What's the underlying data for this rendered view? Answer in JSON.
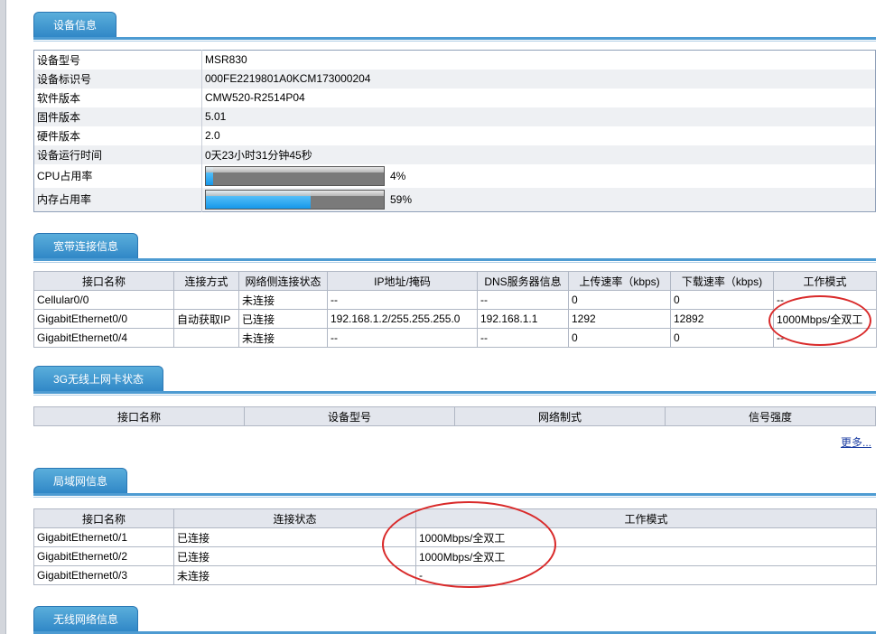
{
  "device_info": {
    "title": "设备信息",
    "rows": [
      {
        "key": "设备型号",
        "value": "MSR830"
      },
      {
        "key": "设备标识号",
        "value": "000FE2219801A0KCM173000204"
      },
      {
        "key": "软件版本",
        "value": "CMW520-R2514P04"
      },
      {
        "key": "固件版本",
        "value": "5.01"
      },
      {
        "key": "硬件版本",
        "value": "2.0"
      },
      {
        "key": "设备运行时间",
        "value": "0天23小时31分钟45秒"
      }
    ],
    "cpu": {
      "key": "CPU占用率",
      "percent": 4,
      "label": "4%"
    },
    "mem": {
      "key": "内存占用率",
      "percent": 59,
      "label": "59%"
    }
  },
  "wan": {
    "title": "宽带连接信息",
    "columns": [
      "接口名称",
      "连接方式",
      "网络侧连接状态",
      "IP地址/掩码",
      "DNS服务器信息",
      "上传速率（kbps)",
      "下载速率（kbps)",
      "工作模式"
    ],
    "rows": [
      [
        "Cellular0/0",
        "",
        "未连接",
        "--",
        "--",
        "0",
        "0",
        "--"
      ],
      [
        "GigabitEthernet0/0",
        "自动获取IP",
        "已连接",
        "192.168.1.2/255.255.255.0",
        "192.168.1.1",
        "1292",
        "12892",
        "1000Mbps/全双工"
      ],
      [
        "GigabitEthernet0/4",
        "",
        "未连接",
        "--",
        "--",
        "0",
        "0",
        "--"
      ]
    ]
  },
  "wireless3g": {
    "title": "3G无线上网卡状态",
    "columns": [
      "接口名称",
      "设备型号",
      "网络制式",
      "信号强度"
    ],
    "more": "更多..."
  },
  "lan": {
    "title": "局域网信息",
    "columns": [
      "接口名称",
      "连接状态",
      "工作模式"
    ],
    "rows": [
      [
        "GigabitEthernet0/1",
        "已连接",
        "1000Mbps/全双工"
      ],
      [
        "GigabitEthernet0/2",
        "已连接",
        "1000Mbps/全双工"
      ],
      [
        "GigabitEthernet0/3",
        "未连接",
        "-"
      ]
    ]
  },
  "wlan": {
    "title": "无线网络信息"
  },
  "colors": {
    "tab": "#3a92cc",
    "annotation": "#d92a2a",
    "header_bg": "#e3e6ed"
  }
}
